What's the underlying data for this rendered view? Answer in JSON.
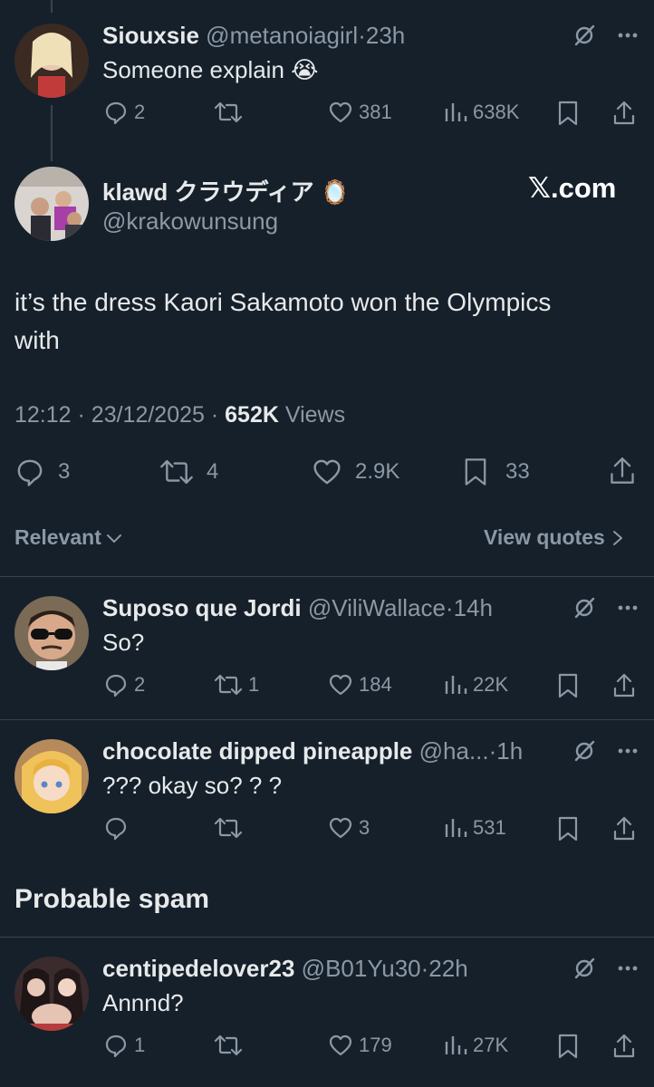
{
  "colors": {
    "background": "#15202b",
    "text": "#e7e9ea",
    "muted": "#8b98a5",
    "divider": "#38444d"
  },
  "top_post": {
    "name": "Siouxsie",
    "handle": "@metanoiagirl",
    "sep": "·",
    "time": "23h",
    "text": "Someone explain",
    "emoji": "😭",
    "replies": "2",
    "reposts": "",
    "likes": "381",
    "views": "638K"
  },
  "main_post": {
    "name": "klawd クラウディア",
    "badge_emoji": "🪞",
    "handle": "@krakowunsung",
    "watermark": "𝕏.com",
    "text_line1": "it’s the dress Kaori Sakamoto won the Olympics",
    "text_line2": "with",
    "time": "12:12",
    "date": "23/12/2025",
    "views_count": "652K",
    "views_label": "Views",
    "sep": "·",
    "replies": "3",
    "reposts": "4",
    "likes": "2.9K",
    "bookmarks": "33"
  },
  "sort_bar": {
    "relevant_label": "Relevant",
    "view_quotes_label": "View quotes"
  },
  "replies": [
    {
      "name": "Suposo que Jordi",
      "handle": "@ViliWallace",
      "sep": "·",
      "time": "14h",
      "text": "So?",
      "replies": "2",
      "reposts": "1",
      "likes": "184",
      "views": "22K"
    },
    {
      "name": "chocolate dipped pineapple",
      "handle": "@ha...",
      "sep": "·",
      "time": "1h",
      "text": "??? okay so? ? ?",
      "replies": "",
      "reposts": "",
      "likes": "3",
      "views": "531"
    }
  ],
  "spam_section": {
    "heading": "Probable spam"
  },
  "spam_reply": {
    "name": "centipedelover23",
    "handle": "@B01Yu30",
    "sep": "·",
    "time": "22h",
    "text": "Annnd?",
    "replies": "1",
    "reposts": "",
    "likes": "179",
    "views": "27K"
  },
  "icons": {
    "reply": "reply-icon",
    "repost": "repost-icon",
    "like": "heart-icon",
    "views": "views-bar-chart-icon",
    "bookmark": "bookmark-icon",
    "share": "share-icon",
    "grok": "grok-slash-icon",
    "more": "more-dots-icon"
  }
}
